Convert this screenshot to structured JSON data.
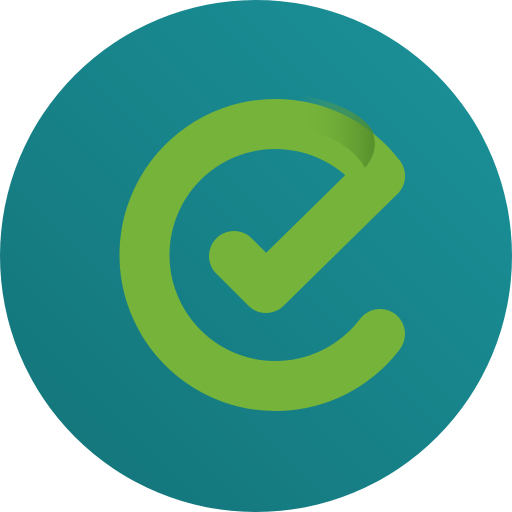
{
  "logo": {
    "icon": "e-checkmark-logo-icon",
    "colors": {
      "circle_light": "#1B929A",
      "circle_dark": "#137378",
      "mark_green": "#76B33A",
      "mark_shadow": "#4F8A2A"
    }
  }
}
